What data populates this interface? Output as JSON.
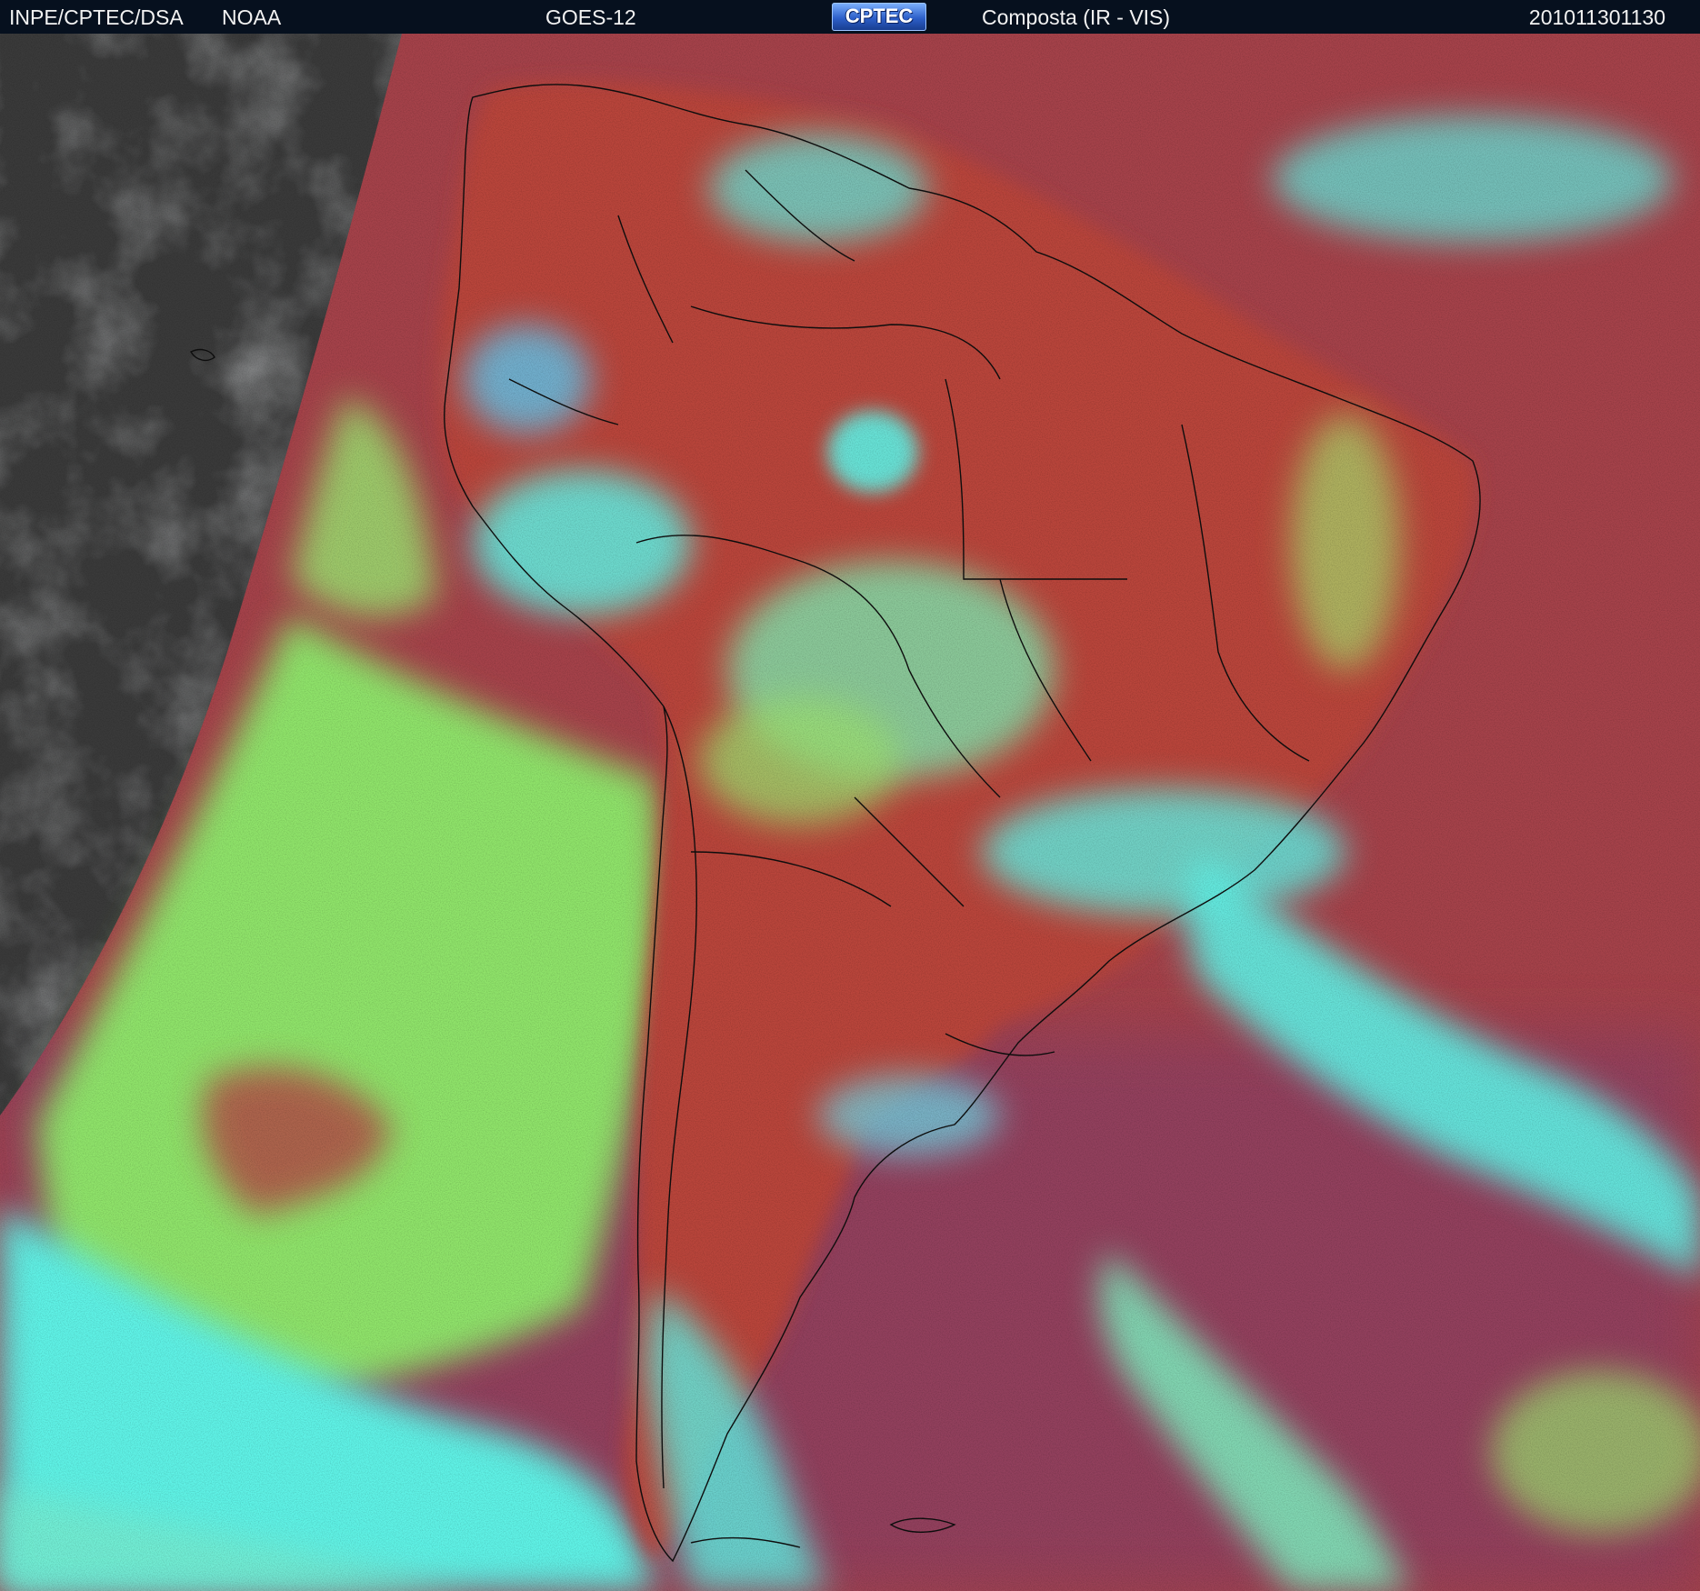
{
  "header": {
    "organization": "INPE/CPTEC/DSA",
    "agency": "NOAA",
    "satellite": "GOES-12",
    "logo_text": "CPTEC",
    "product": "Composta (IR - VIS)",
    "timestamp": "201011301130"
  },
  "map": {
    "region": "South America",
    "colors": {
      "clear_land": "#b8443a",
      "clear_ocean": "#8f3f5c",
      "low_cloud": "#8fe36a",
      "high_cloud": "#5ff2e6",
      "outside_vis": "#3a3a3a",
      "header_bg": "#06101e"
    }
  }
}
